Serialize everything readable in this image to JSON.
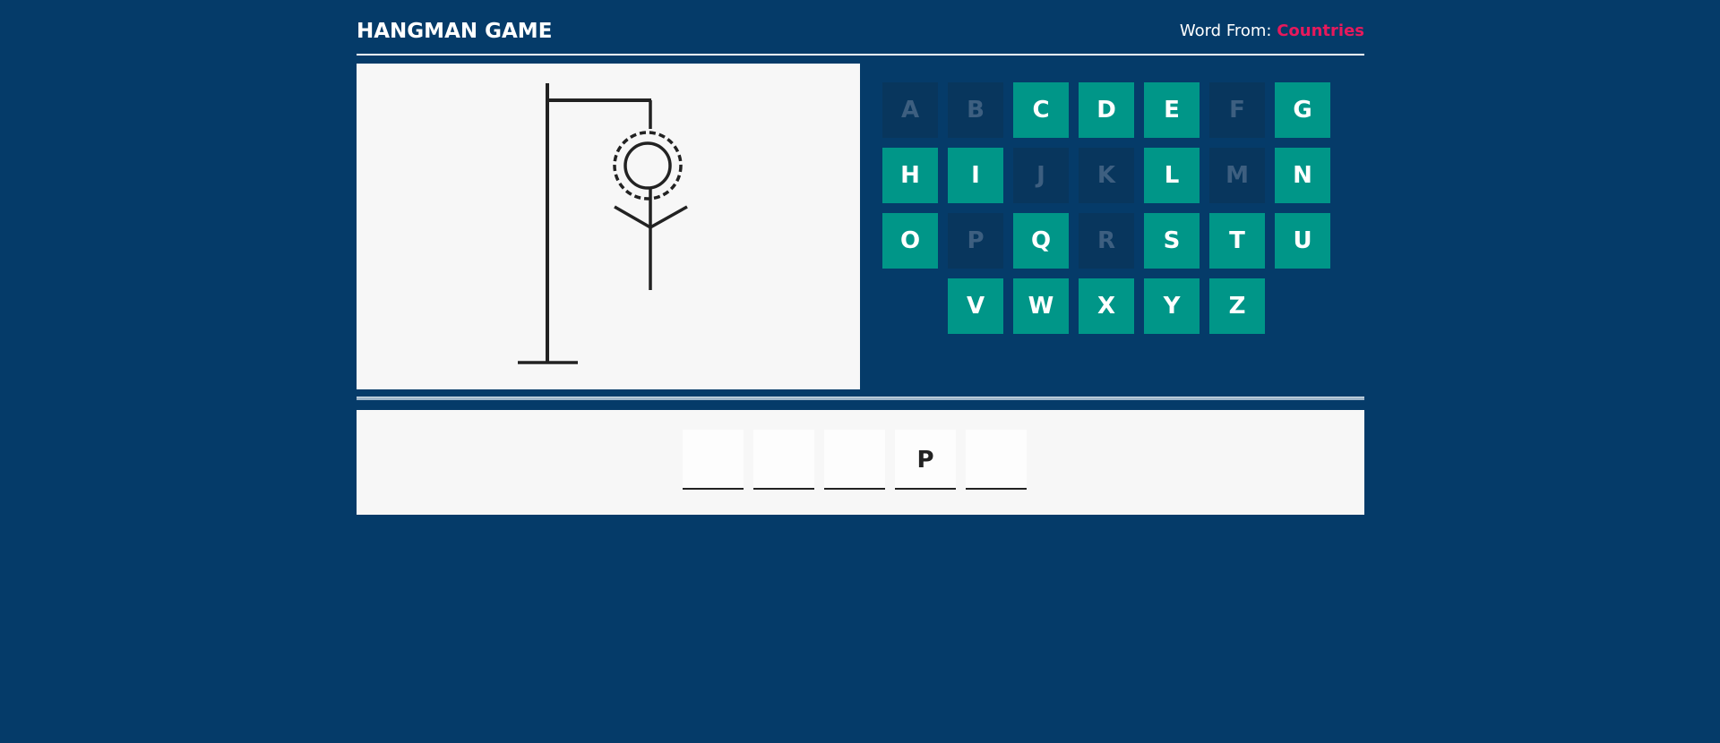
{
  "header": {
    "title": "HANGMAN GAME",
    "word_from_label": "Word From:",
    "category": "Countries"
  },
  "colors": {
    "background": "#053b69",
    "panel": "#f7f7f7",
    "key_active": "#009688",
    "key_used": "#08365d",
    "category_accent": "#e7195c"
  },
  "keyboard": {
    "keys": [
      {
        "letter": "A",
        "used": true
      },
      {
        "letter": "B",
        "used": true
      },
      {
        "letter": "C",
        "used": false
      },
      {
        "letter": "D",
        "used": false
      },
      {
        "letter": "E",
        "used": false
      },
      {
        "letter": "F",
        "used": true
      },
      {
        "letter": "G",
        "used": false
      },
      {
        "letter": "H",
        "used": false
      },
      {
        "letter": "I",
        "used": false
      },
      {
        "letter": "J",
        "used": true
      },
      {
        "letter": "K",
        "used": true
      },
      {
        "letter": "L",
        "used": false
      },
      {
        "letter": "M",
        "used": true
      },
      {
        "letter": "N",
        "used": false
      },
      {
        "letter": "O",
        "used": false
      },
      {
        "letter": "P",
        "used": true
      },
      {
        "letter": "Q",
        "used": false
      },
      {
        "letter": "R",
        "used": true
      },
      {
        "letter": "S",
        "used": false
      },
      {
        "letter": "T",
        "used": false
      },
      {
        "letter": "U",
        "used": false
      },
      {
        "letter": "V",
        "used": false
      },
      {
        "letter": "W",
        "used": false
      },
      {
        "letter": "X",
        "used": false
      },
      {
        "letter": "Y",
        "used": false
      },
      {
        "letter": "Z",
        "used": false
      }
    ]
  },
  "word": {
    "slots": [
      "",
      "",
      "",
      "P",
      ""
    ]
  },
  "hangman": {
    "parts_shown": [
      "gallows-base",
      "gallows-pole",
      "gallows-beam",
      "rope",
      "head",
      "body",
      "left-arm",
      "right-arm"
    ]
  }
}
